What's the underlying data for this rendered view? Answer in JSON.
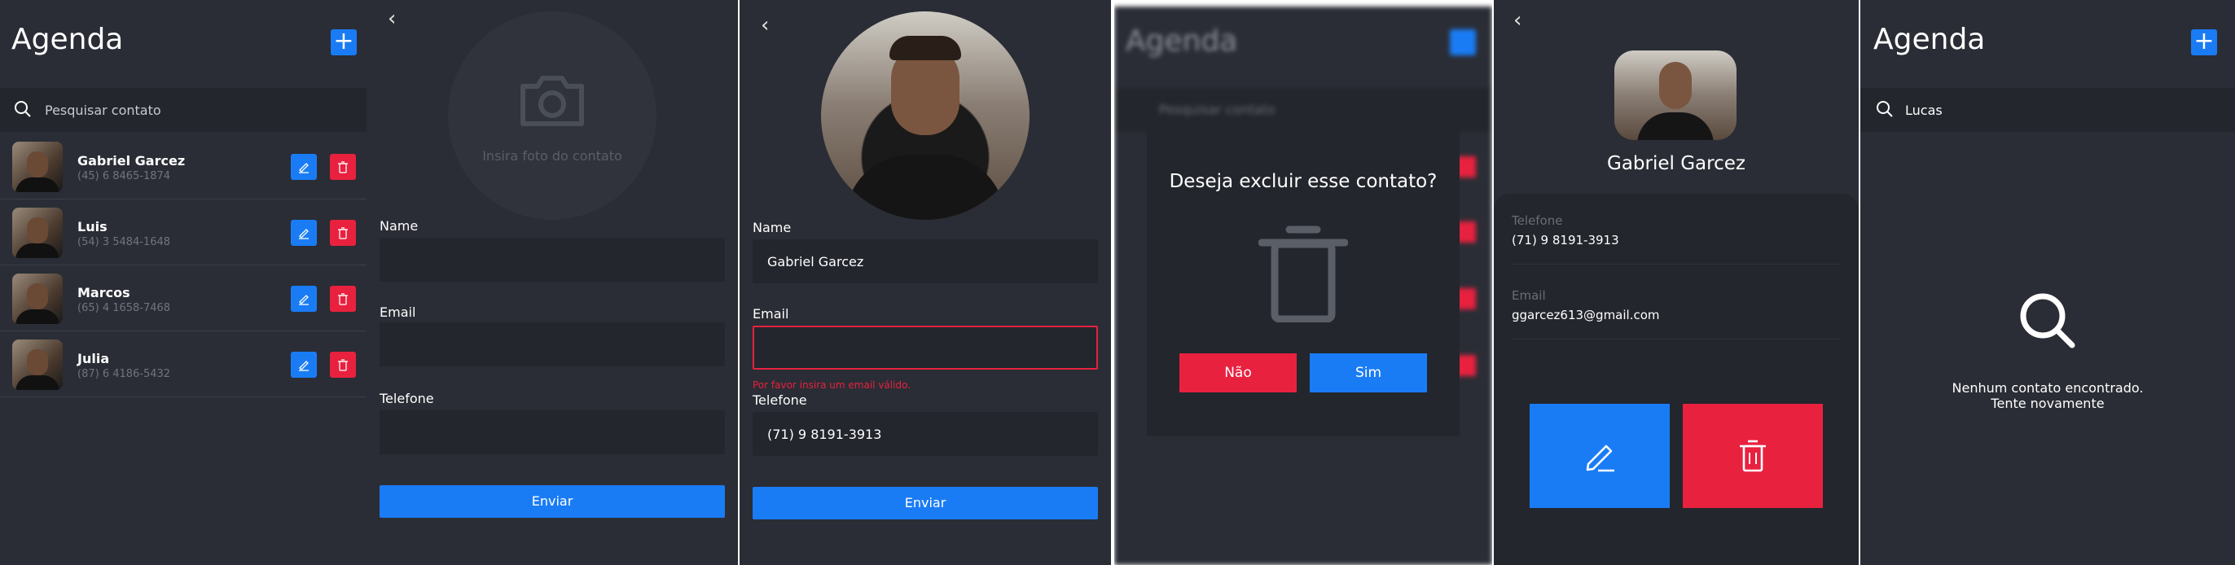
{
  "screen1": {
    "title": "Agenda",
    "add_label": "+",
    "search_placeholder": "Pesquisar contato",
    "contacts": [
      {
        "name": "Gabriel Garcez",
        "phone": "(45) 6 8465-1874"
      },
      {
        "name": "Luis",
        "phone": "(54) 3 5484-1648"
      },
      {
        "name": "Marcos",
        "phone": "(65) 4 1658-7468"
      },
      {
        "name": "Julia",
        "phone": "(87) 6 4186-5432"
      }
    ]
  },
  "screen2": {
    "back_label": "‹",
    "photo_hint": "Insira foto do contato",
    "name_label": "Name",
    "email_label": "Email",
    "phone_label": "Telefone",
    "submit_label": "Enviar"
  },
  "screen3": {
    "back_label": "‹",
    "name_label": "Name",
    "name_value": "Gabriel Garcez",
    "email_label": "Email",
    "email_value": "",
    "email_error": "Por favor insira um email válido.",
    "phone_label": "Telefone",
    "phone_value": "(71) 9 8191-3913",
    "submit_label": "Enviar"
  },
  "screen4": {
    "bg_title": "Agenda",
    "bg_search": "Pesquisar contato",
    "modal_question": "Deseja excluir esse contato?",
    "no_label": "Não",
    "yes_label": "Sim"
  },
  "screen5": {
    "back_label": "‹",
    "contact_name": "Gabriel Garcez",
    "phone_label": "Telefone",
    "phone_value": "(71) 9 8191-3913",
    "email_label": "Email",
    "email_value": "ggarcez613@gmail.com"
  },
  "screen6": {
    "title": "Agenda",
    "add_label": "+",
    "search_value": "Lucas",
    "empty_line1": "Nenhum contato encontrado.",
    "empty_line2": "Tente novamente"
  },
  "colors": {
    "background": "#2a2d35",
    "input": "#23262d",
    "accent_blue": "#1a7cf5",
    "danger_red": "#e8213f",
    "error_text": "#e8213f"
  },
  "icons": [
    "search-icon",
    "edit-icon",
    "trash-icon",
    "camera-icon",
    "back-chevron-icon",
    "plus-icon"
  ]
}
